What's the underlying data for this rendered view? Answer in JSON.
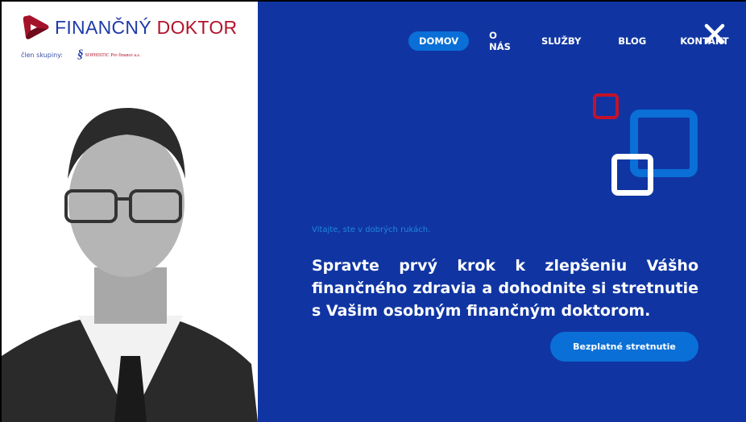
{
  "brand": {
    "name_part1": "FINANČNÝ",
    "name_part2": "DOKTOR",
    "member_label": "člen skupiny:",
    "partner_name": "SOPHISTIC Pro finance a.s."
  },
  "nav": {
    "items": [
      {
        "label": "DOMOV",
        "active": true
      },
      {
        "label": "O NÁS"
      },
      {
        "label": "SLUŽBY"
      },
      {
        "label": "BLOG"
      },
      {
        "label": "KONTAKT"
      }
    ],
    "close_icon": "close-icon"
  },
  "hero": {
    "tagline": "Vitajte, ste v dobrých rukách.",
    "headline": "Spravte prvý krok k zlepšeniu Vášho finančného zdravia a dohodnite si stretnutie s Vašim osobným finančným doktorom.",
    "cta": "Bezplatné stretnutie"
  },
  "colors": {
    "background": "#1035a3",
    "accent": "#0a6fd6",
    "brand_red": "#b3122b"
  }
}
